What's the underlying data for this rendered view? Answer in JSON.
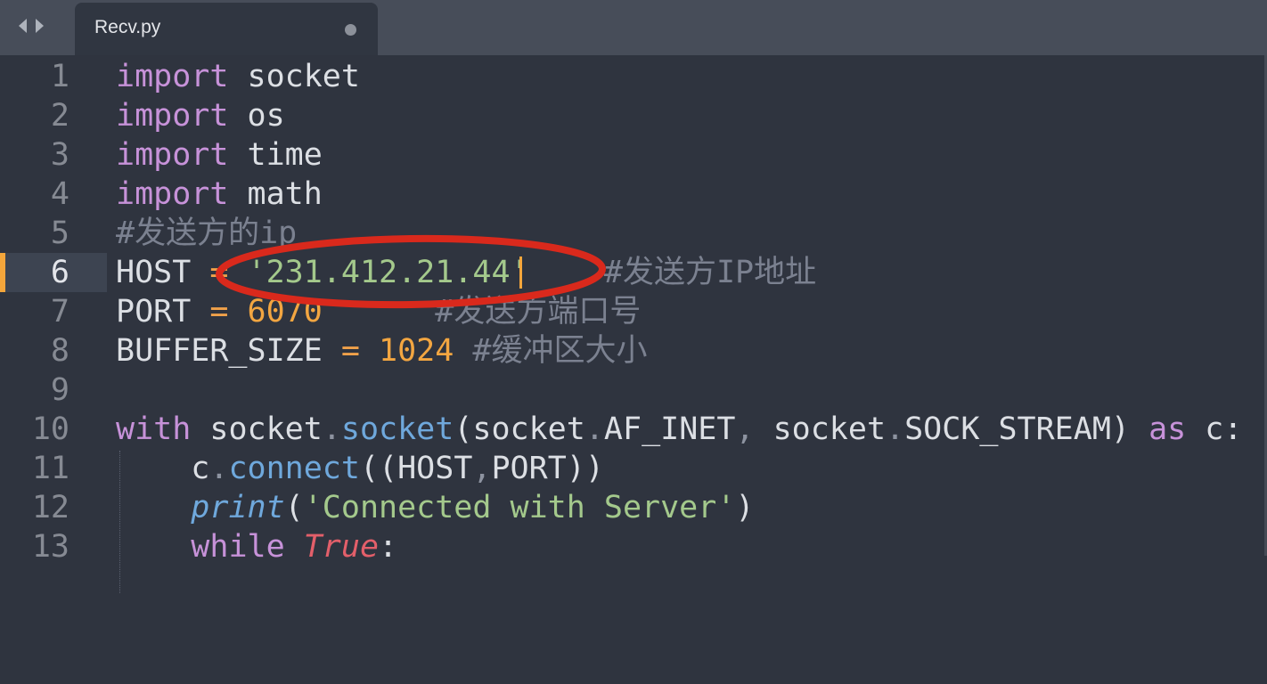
{
  "tab": {
    "title": "Recv.py",
    "modified": true
  },
  "nav": {
    "back_icon": "chevron-left-icon",
    "forward_icon": "chevron-right-icon"
  },
  "editor": {
    "current_line": 6,
    "lines": [
      {
        "num": "1",
        "tokens": {
          "kw": "import",
          "sp": " ",
          "name": "socket"
        }
      },
      {
        "num": "2",
        "tokens": {
          "kw": "import",
          "sp": " ",
          "name": "os"
        }
      },
      {
        "num": "3",
        "tokens": {
          "kw": "import",
          "sp": " ",
          "name": "time"
        }
      },
      {
        "num": "4",
        "tokens": {
          "kw": "import",
          "sp": " ",
          "name": "math"
        }
      },
      {
        "num": "5",
        "tokens": {
          "comment": "#发送方的ip"
        }
      },
      {
        "num": "6",
        "tokens": {
          "name": "HOST",
          "sp1": " ",
          "op": "=",
          "sp2": " ",
          "str": "'231.412.21.44'",
          "sp3": "    ",
          "comment": "#发送方IP地址"
        }
      },
      {
        "num": "7",
        "tokens": {
          "name": "PORT",
          "sp1": " ",
          "op": "=",
          "sp2": " ",
          "num": "6070",
          "sp3": "      ",
          "comment": "#发送方端口号"
        }
      },
      {
        "num": "8",
        "tokens": {
          "name": "BUFFER_SIZE",
          "sp1": " ",
          "op": "=",
          "sp2": " ",
          "num": "1024",
          "sp3": " ",
          "comment": "#缓冲区大小"
        }
      },
      {
        "num": "9",
        "tokens": {}
      },
      {
        "num": "10",
        "tokens": {
          "kw": "with",
          "a": " socket",
          "dot": ".",
          "fn": "socket",
          "b": "(socket",
          "dot2": ".",
          "c": "AF_INET",
          "comma": ",",
          "d": " socket",
          "dot3": ".",
          "e": "SOCK_STREAM)",
          "sp": " ",
          "kw2": "as",
          "f": " c:"
        }
      },
      {
        "num": "11",
        "tokens": {
          "indent": "    ",
          "a": "c",
          "dot": ".",
          "fn": "connect",
          "b": "((HOST",
          "comma": ",",
          "c": "PORT))"
        }
      },
      {
        "num": "12",
        "tokens": {
          "indent": "    ",
          "builtin": "print",
          "a": "(",
          "str": "'Connected with Server'",
          "b": ")"
        }
      },
      {
        "num": "13",
        "tokens": {
          "indent": "    ",
          "kw": "while",
          "sp": " ",
          "const": "True",
          "a": ":"
        }
      }
    ]
  },
  "annotation": {
    "color": "#d9291c",
    "target": "HOST value on line 6"
  }
}
